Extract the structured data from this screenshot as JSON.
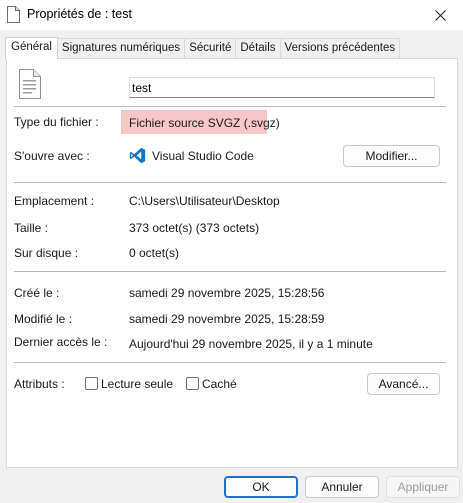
{
  "window": {
    "title": "Propriétés de : test"
  },
  "tabs": [
    {
      "label": "Général",
      "active": true
    },
    {
      "label": "Signatures numériques",
      "active": false
    },
    {
      "label": "Sécurité",
      "active": false
    },
    {
      "label": "Détails",
      "active": false
    },
    {
      "label": "Versions précédentes",
      "active": false
    }
  ],
  "general": {
    "file_name": "test",
    "file_type_label": "Type du fichier :",
    "file_type_value": "Fichier source SVGZ (.svgz)",
    "opens_with_label": "S'ouvre avec :",
    "opens_with_value": "Visual Studio Code",
    "change_button": "Modifier...",
    "location_label": "Emplacement :",
    "location_value": "C:\\Users\\Utilisateur\\Desktop",
    "size_label": "Taille :",
    "size_value": "373 octet(s) (373 octets)",
    "disk_size_label": "Sur disque :",
    "disk_size_value": "0 octet(s)",
    "created_label": "Créé le :",
    "created_value": "samedi 29 novembre 2025, 15:28:56",
    "modified_label": "Modifié le :",
    "modified_value": "samedi 29 novembre 2025, 15:28:59",
    "accessed_label": "Dernier accès le :",
    "accessed_value": "Aujourd'hui 29 novembre 2025, il y a 1 minute",
    "attributes_label": "Attributs :",
    "readonly_label": "Lecture seule",
    "hidden_label": "Caché",
    "advanced_button": "Avancé..."
  },
  "footer": {
    "ok": "OK",
    "cancel": "Annuler",
    "apply": "Appliquer"
  },
  "icons": {
    "title": "document-icon",
    "file": "document-icon",
    "app": "vscode-icon",
    "close": "close-icon"
  },
  "colors": {
    "highlight": "#f7c6c6",
    "vscode_blue": "#0f77c8",
    "primary_border": "#1f6fc9"
  }
}
